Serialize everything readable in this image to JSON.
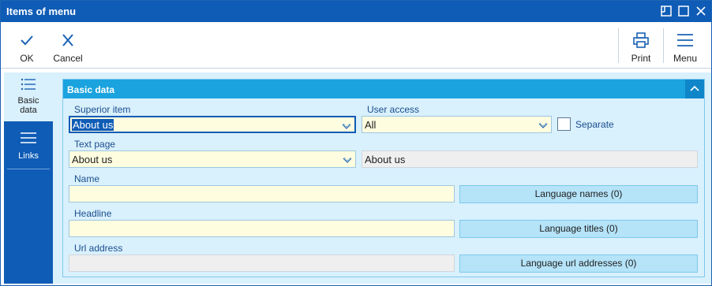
{
  "window": {
    "title": "Items of menu",
    "controls": [
      "restore-icon",
      "maximize-icon",
      "close-icon"
    ]
  },
  "toolbar": {
    "ok_label": "OK",
    "cancel_label": "Cancel",
    "print_label": "Print",
    "menu_label": "Menu"
  },
  "nav": {
    "items": [
      {
        "label": "Basic data",
        "icon": "list-icon",
        "active": true
      },
      {
        "label": "Links",
        "icon": "lines-icon",
        "active": false
      }
    ]
  },
  "panel": {
    "title": "Basic data"
  },
  "form": {
    "superior_item": {
      "label": "Superior item",
      "value": "About us"
    },
    "user_access": {
      "label": "User access",
      "value": "All"
    },
    "separate": {
      "label": "Separate",
      "checked": false
    },
    "text_page": {
      "label": "Text page",
      "value": "About us",
      "display": "About us"
    },
    "name": {
      "label": "Name",
      "value": ""
    },
    "headline": {
      "label": "Headline",
      "value": ""
    },
    "url_address": {
      "label": "Url address",
      "value": ""
    }
  },
  "buttons": {
    "language_names": "Language names (0)",
    "language_titles": "Language titles (0)",
    "language_url_addresses": "Language url addresses (0)"
  },
  "colors": {
    "titlebar": "#0f5cb6",
    "panel_header": "#1aa3df",
    "content_bg": "#d9f0fd",
    "field_bg": "#fffde0"
  }
}
